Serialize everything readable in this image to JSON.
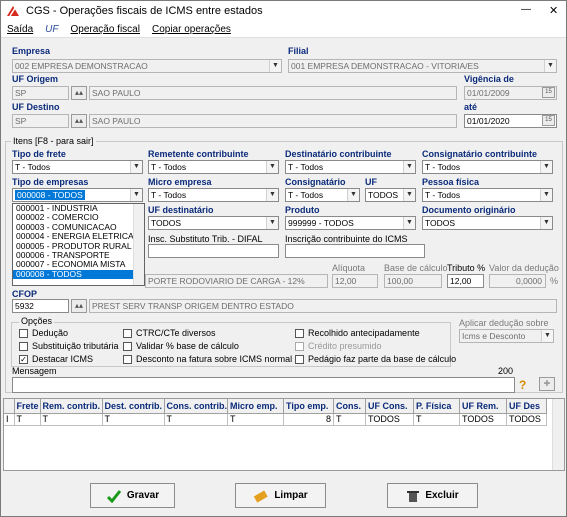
{
  "window": {
    "title": "CGS - Operações fiscais de ICMS entre estados",
    "min": "—",
    "close": "✕"
  },
  "menu": [
    "Saída",
    "UF",
    "Operação fiscal",
    "Copiar operações"
  ],
  "empresa": {
    "label": "Empresa",
    "value": "002 EMPRESA DEMONSTRACAO"
  },
  "filial": {
    "label": "Filial",
    "value": "001 EMPRESA DEMONSTRACAO - VITORIA/ES"
  },
  "uf_origem": {
    "label": "UF Origem",
    "code": "SP",
    "name": "SAO PAULO"
  },
  "vigencia": {
    "label": "Vigência de",
    "value": "01/01/2009"
  },
  "uf_destino": {
    "label": "UF Destino",
    "code": "SP",
    "name": "SAO PAULO"
  },
  "ate": {
    "label": "até",
    "value": "01/01/2020"
  },
  "itens": {
    "legend": "Itens [F8 - para sair]"
  },
  "tipo_frete": {
    "label": "Tipo de frete",
    "value": "T - Todos"
  },
  "remetente": {
    "label": "Remetente contribuinte",
    "value": "T - Todos"
  },
  "destinatario": {
    "label": "Destinatário contribuinte",
    "value": "T - Todos"
  },
  "consignatario_contrib": {
    "label": "Consignatário contribuinte",
    "value": "T - Todos"
  },
  "tipo_empresas": {
    "label": "Tipo de empresas",
    "value": "000008 - TODOS",
    "options": [
      "000001 - INDUSTRIA",
      "000002 - COMERCIO",
      "000003 - COMUNICACAO",
      "000004 - ENERGIA ELETRICA",
      "000005 - PRODUTOR RURAL",
      "000006 - TRANSPORTE",
      "000007 - ECONOMIA MISTA",
      "000008 - TODOS"
    ],
    "selected_index": 7
  },
  "micro_empresa": {
    "label": "Micro empresa",
    "value": "T - Todos"
  },
  "consignatario": {
    "label": "Consignatário",
    "value": "T - Todos"
  },
  "uf": {
    "label": "UF",
    "value": "TODOS"
  },
  "pessoa_fisica": {
    "label": "Pessoa física",
    "value": "T - Todos"
  },
  "uf_destinatario": {
    "label": "UF destinatário",
    "value": "TODOS"
  },
  "produto": {
    "label": "Produto",
    "value": "999999 - TODOS"
  },
  "documento": {
    "label": "Documento originário",
    "value": "TODOS"
  },
  "insc_subst": {
    "label": "Insc. Substituto Trib. - DIFAL"
  },
  "insc_contrib": {
    "label": "Inscrição contribuinte do ICMS"
  },
  "modal_text": "PORTE RODOVIARIO DE CARGA - 12%",
  "aliquota": {
    "label": "Alíquota",
    "value": "12,00"
  },
  "base_calculo": {
    "label": "Base de cálculo",
    "value": "100,00"
  },
  "tributo": {
    "label": "Tributo %",
    "value": "12,00"
  },
  "valor_deducao": {
    "label": "Valor da dedução",
    "value": "0,0000",
    "unit": "%"
  },
  "cfop": {
    "label": "CFOP",
    "code": "5932",
    "desc": "PREST SERV TRANSP ORIGEM DENTRO ESTADO"
  },
  "opcoes": {
    "legend": "Opções",
    "items": [
      {
        "label": "Dedução",
        "checked": false,
        "enabled": true
      },
      {
        "label": "Substituição tributária",
        "checked": false,
        "enabled": true
      },
      {
        "label": "Destacar ICMS",
        "checked": true,
        "enabled": true
      },
      {
        "label": "CTRC/CTe diversos",
        "checked": false,
        "enabled": true
      },
      {
        "label": "Validar % base de cálculo",
        "checked": false,
        "enabled": true
      },
      {
        "label": "Desconto na fatura sobre ICMS normal",
        "checked": false,
        "enabled": true
      },
      {
        "label": "Recolhido antecipadamente",
        "checked": false,
        "enabled": true
      },
      {
        "label": "Crédito presumido",
        "checked": false,
        "enabled": false
      },
      {
        "label": "Pedágio faz parte da base de cálculo",
        "checked": false,
        "enabled": true
      }
    ]
  },
  "aplicar_deducao": {
    "label": "Aplicar dedução sobre",
    "value": "Icms e Desconto"
  },
  "mensagem": {
    "label": "Mensagem",
    "counter": "200"
  },
  "table": {
    "columns": [
      "Frete",
      "Rem. contrib.",
      "Dest. contrib.",
      "Cons. contrib.",
      "Micro emp.",
      "Tipo emp.",
      "Cons.",
      "UF Cons.",
      "P. Física",
      "UF Rem.",
      "UF Des"
    ],
    "rows": [
      [
        "T",
        "T",
        "T",
        "T",
        "T",
        "8",
        "T",
        "TODOS",
        "T",
        "TODOS",
        "TODOS"
      ]
    ],
    "row_marker": "I"
  },
  "buttons": {
    "gravar": "Gravar",
    "limpar": "Limpar",
    "excluir": "Excluir"
  }
}
